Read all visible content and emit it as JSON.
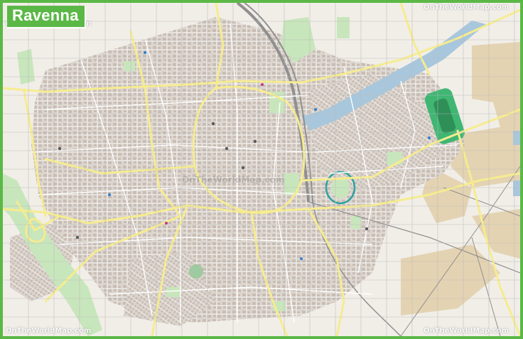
{
  "title": "Ravenna",
  "watermark": "OnTheWorldMap.com",
  "colors": {
    "frame": "#5bb847",
    "land": "#f1eee8",
    "urban": "#dcd6cf",
    "building": "#c9bdb4",
    "park": "#c8e6bc",
    "industrial": "#e4d3b2",
    "water": "#a8c7dc",
    "road_major": "#f6ec8f",
    "road_minor": "#ffffff",
    "rail": "#8f8f8f",
    "grid": "#b9b9b9",
    "stadium": "#40b673"
  }
}
